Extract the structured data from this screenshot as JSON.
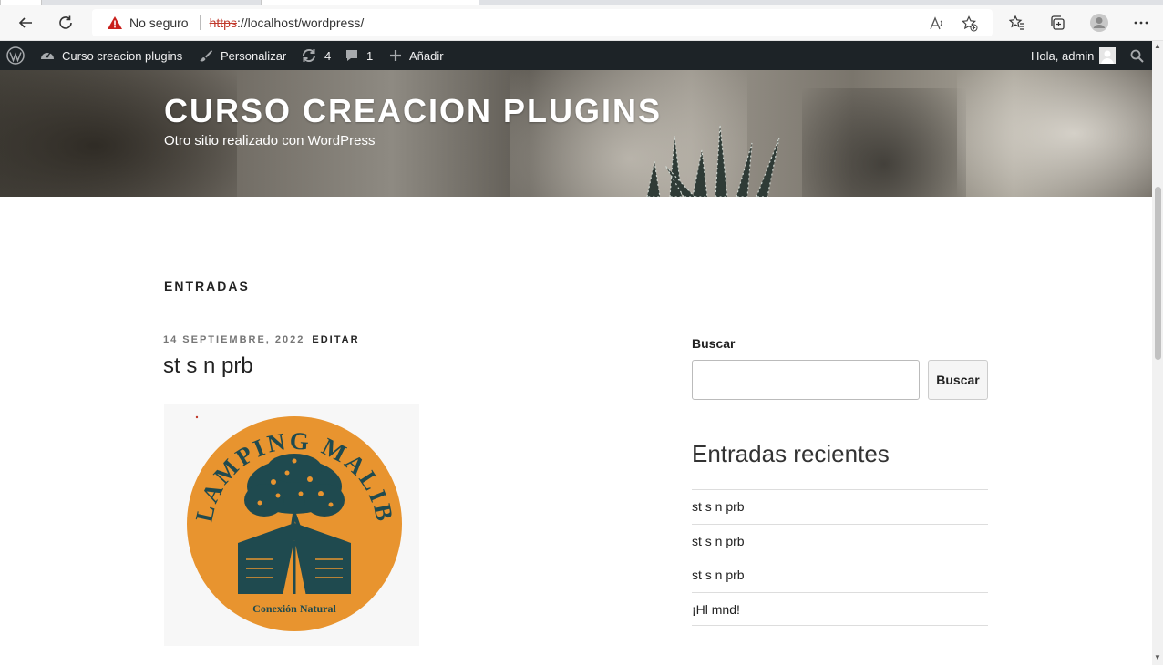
{
  "browser": {
    "address": {
      "security_label": "No seguro",
      "url_scheme": "https",
      "url_rest": "://localhost/wordpress/"
    },
    "icons": [
      "back-icon",
      "reload-icon",
      "warning-icon",
      "read-aloud-icon",
      "add-favorite-icon",
      "favorites-icon",
      "collections-icon",
      "profile-icon",
      "more-icon"
    ]
  },
  "adminbar": {
    "site_name": "Curso creacion plugins",
    "customize": "Personalizar",
    "updates_count": "4",
    "comments_count": "1",
    "add_new": "Añadir",
    "greeting": "Hola, admin"
  },
  "header": {
    "site_title": "CURSO CREACION PLUGINS",
    "site_description": "Otro sitio realizado con WordPress"
  },
  "main": {
    "page_title": "ENTRADAS",
    "post": {
      "date": "14 SEPTIEMBRE, 2022",
      "edit": "EDITAR",
      "title": "st s n prb",
      "image": {
        "logo_top_text": "GLAMPING MALIBÚ",
        "logo_bottom_text": "Conexión Natural",
        "colors": {
          "circle": "#e8942f",
          "dark": "#1f4a4f"
        }
      }
    }
  },
  "sidebar": {
    "search_label": "Buscar",
    "search_value": "",
    "search_button": "Buscar",
    "recent_heading": "Entradas recientes",
    "recent_posts": [
      "st s n prb",
      "st s n prb",
      "st s n prb",
      "¡Hl mnd!"
    ]
  },
  "colors": {
    "adminbar_bg": "#1d2327",
    "text": "#222222",
    "meta_gray": "#767676"
  }
}
